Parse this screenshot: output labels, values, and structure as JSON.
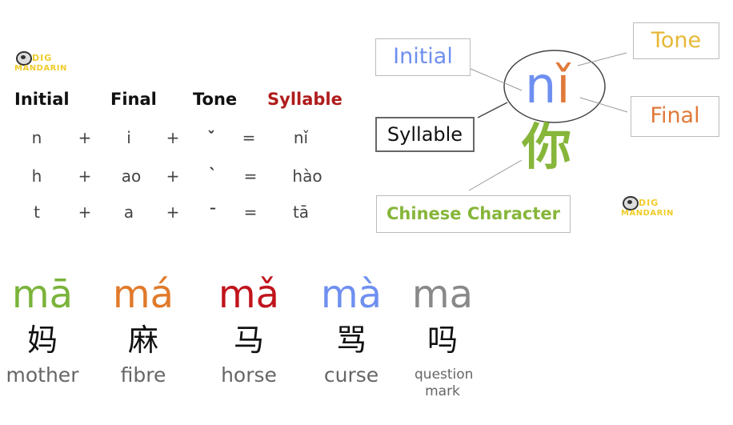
{
  "logo": {
    "line1": "DIG",
    "line2": "MANDARIN"
  },
  "table": {
    "headers": [
      "Initial",
      "Final",
      "Tone",
      "Syllable"
    ],
    "header_colors": [
      "#111111",
      "#111111",
      "#111111",
      "#b01c1c"
    ],
    "plus": "+",
    "equals": "=",
    "rows": [
      {
        "initial": "n",
        "final": "i",
        "tone": "ˇ",
        "syllable": "nǐ"
      },
      {
        "initial": "h",
        "final": "ao",
        "tone": "ˋ",
        "syllable": "hào"
      },
      {
        "initial": "t",
        "final": "a",
        "tone": "ˉ",
        "syllable": "tā"
      }
    ]
  },
  "diagram": {
    "syllable_initial": "n",
    "syllable_final": "ǐ",
    "character": "你",
    "labels": {
      "initial": "Initial",
      "tone": "Tone",
      "final": "Final",
      "syllable": "Syllable",
      "character": "Chinese Character"
    },
    "colors": {
      "initial": "#6f8ff0",
      "tone": "#e7b836",
      "final": "#e07a3a",
      "syllable": "#111111",
      "character": "#86b63a"
    }
  },
  "tones": [
    {
      "pinyin": "mā",
      "hanzi": "妈",
      "meaning": "mother",
      "color": "#7ab33a"
    },
    {
      "pinyin": "má",
      "hanzi": "麻",
      "meaning": "fibre",
      "color": "#e07a2a"
    },
    {
      "pinyin": "mǎ",
      "hanzi": "马",
      "meaning": "horse",
      "color": "#c0141c"
    },
    {
      "pinyin": "mà",
      "hanzi": "骂",
      "meaning": "curse",
      "color": "#6f8ff0"
    },
    {
      "pinyin": "ma",
      "hanzi": "吗",
      "meaning": "question mark",
      "color": "#888888"
    }
  ]
}
